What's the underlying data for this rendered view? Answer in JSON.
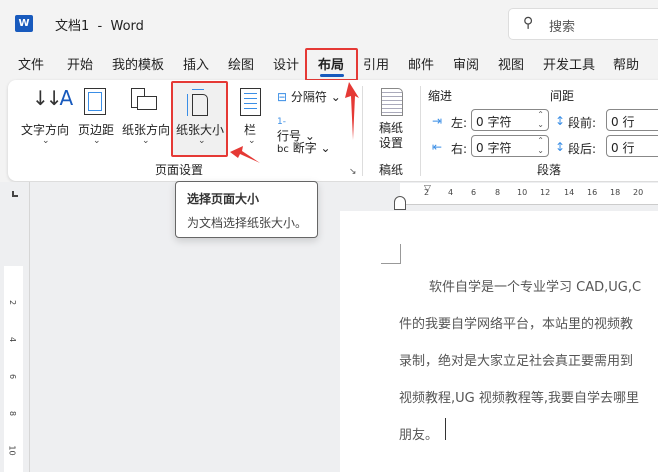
{
  "titlebar": {
    "title": "文档1  -  Word",
    "search_placeholder": "搜索",
    "app_icon": "word-icon"
  },
  "tabs": [
    "文件",
    "开始",
    "我的模板",
    "插入",
    "绘图",
    "设计",
    "布局",
    "引用",
    "邮件",
    "审阅",
    "视图",
    "开发工具",
    "帮助"
  ],
  "active_tab": "布局",
  "ribbon": {
    "page_setup": {
      "text_direction": "文字方向",
      "margins": "页边距",
      "orientation": "纸张方向",
      "size": "纸张大小",
      "columns": "栏",
      "breaks": "分隔符",
      "line_numbers": "行号",
      "hyphenation": "断字",
      "group_label": "页面设置"
    },
    "manuscript": {
      "setup": "稿纸设置",
      "group_label": "稿纸"
    },
    "paragraph": {
      "indent_label": "缩进",
      "spacing_label": "间距",
      "left_label": "左:",
      "right_label": "右:",
      "left_value": "0 字符",
      "right_value": "0 字符",
      "before_label": "段前:",
      "after_label": "段后:",
      "before_value": "0 行",
      "after_value": "0 行",
      "group_label": "段落"
    }
  },
  "tooltip": {
    "title": "选择页面大小",
    "description": "为文档选择纸张大小。"
  },
  "ruler": {
    "h_ticks": [
      "2",
      "4",
      "6",
      "8",
      "10",
      "12",
      "14",
      "16",
      "18",
      "20"
    ],
    "v_ticks": [
      "2",
      "4",
      "6",
      "8",
      "10"
    ]
  },
  "document": {
    "lines": [
      "软件自学是一个专业学习  CAD,UG,C",
      "件的我要自学网络平台，本站里的视频教",
      "录制，绝对是大家立足社会真正要需用到",
      "视频教程,UG 视频教程等,我要自学去哪里",
      "朋友。"
    ]
  },
  "colors": {
    "accent": "#185abd",
    "highlight": "#e53935"
  }
}
